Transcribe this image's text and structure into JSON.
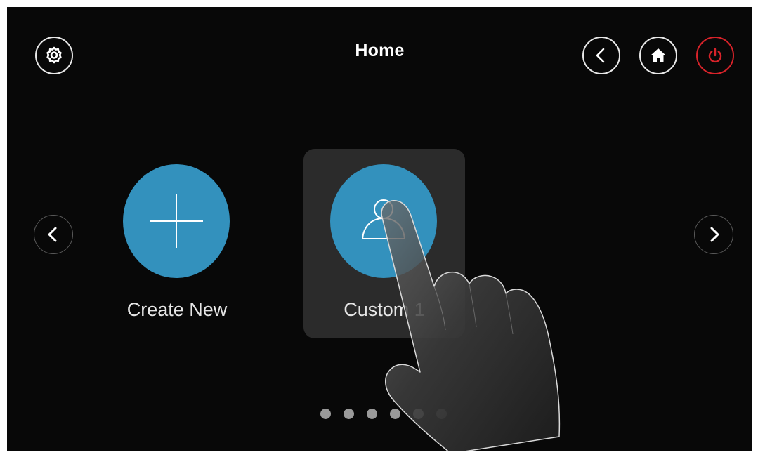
{
  "header": {
    "title": "Home"
  },
  "icons": {
    "settings": "gear-icon",
    "back": "chevron-left-icon",
    "home": "house-icon",
    "power": "power-icon"
  },
  "colors": {
    "background": "#080808",
    "accent": "#3391bd",
    "power": "#d8232a",
    "selected_tile": "#2b2b2b"
  },
  "tiles": [
    {
      "label": "Create New",
      "icon": "plus-icon"
    },
    {
      "label": "Custom 1",
      "icon": "user-icon",
      "selected": true
    }
  ],
  "pagination": {
    "total": 6,
    "active_index": 4
  }
}
